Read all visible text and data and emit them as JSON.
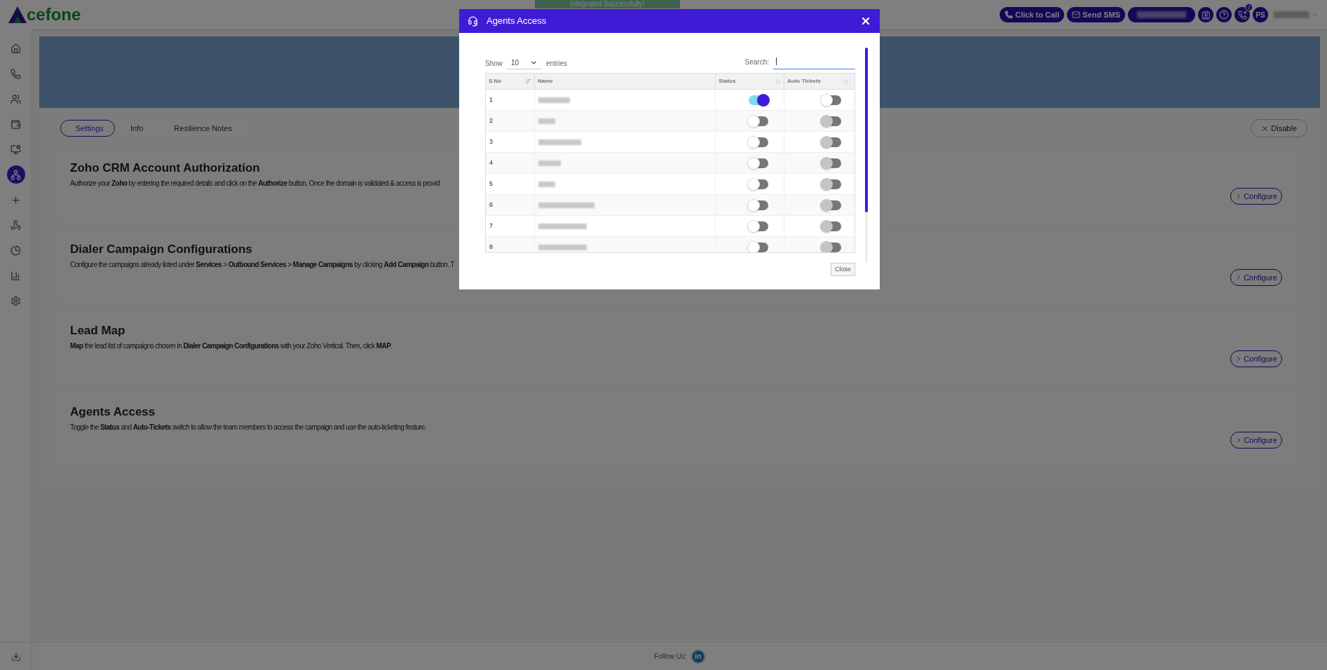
{
  "header": {
    "logo": "cefone",
    "buttons": [
      {
        "kind": "call",
        "label": "Click to Call"
      },
      {
        "kind": "sms",
        "label": "Send SMS"
      }
    ],
    "missed_badge": "0",
    "avatar": "PS"
  },
  "toast": "Integrated Successfully!",
  "sidebar": {
    "items": [
      {
        "kind": "home",
        "selected": false
      },
      {
        "kind": "phone",
        "selected": false
      },
      {
        "kind": "users",
        "selected": false
      },
      {
        "kind": "wallet",
        "selected": false
      },
      {
        "kind": "monitor",
        "selected": false
      },
      {
        "kind": "network",
        "selected": true
      },
      {
        "kind": "plus",
        "selected": false
      },
      {
        "kind": "webhook",
        "selected": false
      },
      {
        "kind": "pie",
        "selected": false
      },
      {
        "kind": "bars",
        "selected": false
      },
      {
        "kind": "settings",
        "selected": false
      }
    ]
  },
  "tabs": [
    {
      "label": "Settings",
      "selected": true
    },
    {
      "label": "Info",
      "selected": false
    },
    {
      "label": "Resilience Notes",
      "selected": false
    }
  ],
  "disable_button": "Disable",
  "cards": [
    {
      "title": "Zoho CRM Account Authorization",
      "description": "Authorize your **Zoho** by entering the required details and click on the **Authorize** button. Once the domain is validated & access is provid",
      "button": "Configure"
    },
    {
      "title": "Dialer Campaign Configurations",
      "description": "Configure the campaigns already listed under **Services** > **Outbound Services** > **Manage Campaigns** by clicking **Add Campaign** button. T",
      "button": "Configure"
    },
    {
      "title": "Lead Map",
      "description": "**Map** the lead list of campaigns chosen in **Dialer Campaign Configurations** with your Zoho Vertical. Then, click **MAP**.",
      "button": "Configure"
    },
    {
      "title": "Agents Access",
      "description": "Toggle the **Status** and **Auto-Tickets** switch to allow the team members to access the campaign and use the auto-ticketing feature.",
      "button": "Configure"
    }
  ],
  "modal": {
    "title": "Agents Access",
    "show_label": "Show",
    "page_size": "10",
    "entries_label": "entries",
    "search_label": "Search:",
    "columns": [
      "S.No",
      "Name",
      "Status",
      "Auto Tickets"
    ],
    "rows": [
      {
        "sno": "1",
        "status_on": true,
        "auto_on": false,
        "auto_disabled": false
      },
      {
        "sno": "2",
        "status_on": false,
        "auto_on": false,
        "auto_disabled": true
      },
      {
        "sno": "3",
        "status_on": false,
        "auto_on": false,
        "auto_disabled": true
      },
      {
        "sno": "4",
        "status_on": false,
        "auto_on": false,
        "auto_disabled": true
      },
      {
        "sno": "5",
        "status_on": false,
        "auto_on": false,
        "auto_disabled": true
      },
      {
        "sno": "6",
        "status_on": false,
        "auto_on": false,
        "auto_disabled": true
      },
      {
        "sno": "7",
        "status_on": false,
        "auto_on": false,
        "auto_disabled": true
      },
      {
        "sno": "8",
        "status_on": false,
        "auto_on": false,
        "auto_disabled": true
      }
    ],
    "close_button": "Close"
  },
  "footer": {
    "follow_label": "Follow Us:",
    "social": "in"
  }
}
